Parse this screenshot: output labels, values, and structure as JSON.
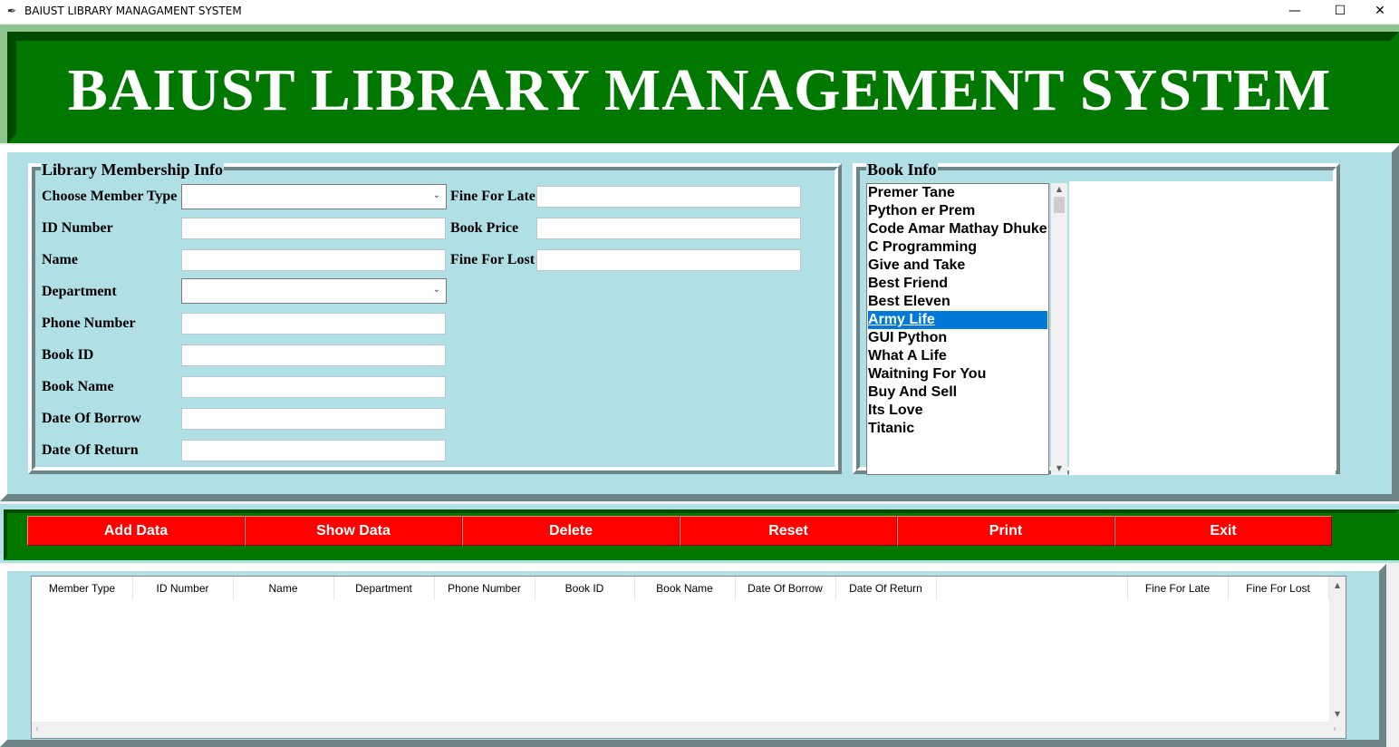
{
  "window": {
    "title": "BAIUST LIBRARY MANAGAMENT SYSTEM",
    "minimize": "—",
    "maximize": "☐",
    "close": "✕"
  },
  "header": {
    "title": "BAIUST LIBRARY MANAGEMENT SYSTEM"
  },
  "membership": {
    "legend": "Library Membership Info",
    "member_type_label": "Choose Member Type",
    "member_type_value": "",
    "id_number_label": "ID Number",
    "id_number_value": "",
    "name_label": "Name",
    "name_value": "",
    "department_label": "Department",
    "department_value": "",
    "phone_label": "Phone Number",
    "phone_value": "",
    "book_id_label": "Book ID",
    "book_id_value": "",
    "book_name_label": "Book Name",
    "book_name_value": "",
    "date_borrow_label": "Date Of Borrow",
    "date_borrow_value": "",
    "date_return_label": "Date Of Return",
    "date_return_value": "",
    "fine_late_label": "Fine For Late",
    "fine_late_value": "",
    "book_price_label": "Book Price",
    "book_price_value": "",
    "fine_lost_label": "Fine For Lost",
    "fine_lost_value": ""
  },
  "book_info": {
    "legend": "Book Info",
    "books": [
      "Premer Tane",
      "Python er Prem",
      "Code Amar Mathay Dhuke",
      "C Programming",
      "Give and Take",
      "Best Friend",
      "Best Eleven",
      "Army Life",
      "GUI Python",
      "What A Life",
      "Waitning For You",
      "Buy And Sell",
      "Its Love",
      "Titanic"
    ],
    "selected": "Army Life",
    "details_text": ""
  },
  "buttons": {
    "add": "Add Data",
    "show": "Show Data",
    "delete": "Delete",
    "reset": "Reset",
    "print": "Print",
    "exit": "Exit"
  },
  "table": {
    "columns": [
      "Member Type",
      "ID Number",
      "Name",
      "Department",
      "Phone Number",
      "Book ID",
      "Book Name",
      "Date Of Borrow",
      "Date Of Return",
      "",
      "Fine For Late",
      "Fine For Lost"
    ],
    "rows": []
  },
  "colors": {
    "header_green": "#007800",
    "frame_blue": "#b0dfe5",
    "button_red": "#ff0000",
    "selection_blue": "#0078d7"
  },
  "icons": {
    "app_icon": "feather-icon",
    "combo_arrow": "chevron-down-icon",
    "scroll_up": "triangle-up-icon",
    "scroll_down": "triangle-down-icon",
    "scroll_left": "triangle-left-icon",
    "scroll_right": "triangle-right-icon"
  }
}
